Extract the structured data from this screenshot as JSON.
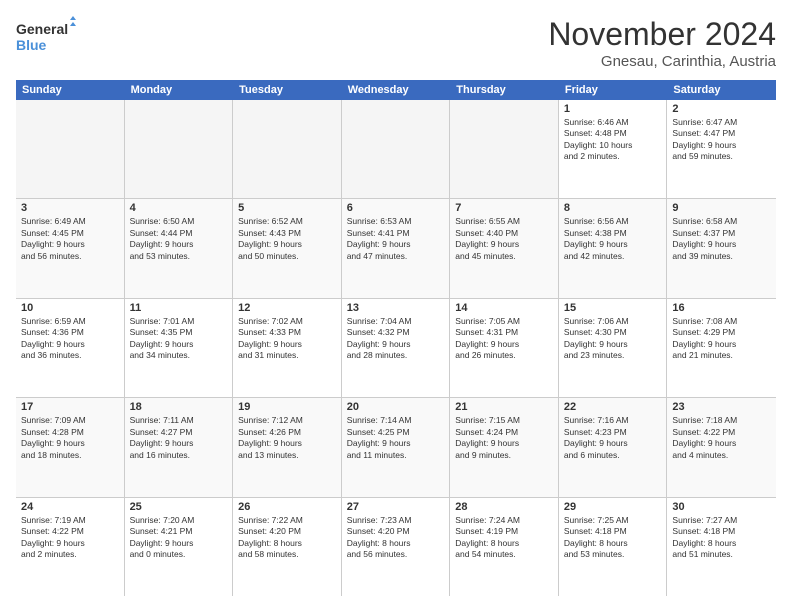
{
  "logo": {
    "line1": "General",
    "line2": "Blue"
  },
  "title": "November 2024",
  "subtitle": "Gnesau, Carinthia, Austria",
  "header_days": [
    "Sunday",
    "Monday",
    "Tuesday",
    "Wednesday",
    "Thursday",
    "Friday",
    "Saturday"
  ],
  "weeks": [
    [
      {
        "day": "",
        "info": ""
      },
      {
        "day": "",
        "info": ""
      },
      {
        "day": "",
        "info": ""
      },
      {
        "day": "",
        "info": ""
      },
      {
        "day": "",
        "info": ""
      },
      {
        "day": "1",
        "info": "Sunrise: 6:46 AM\nSunset: 4:48 PM\nDaylight: 10 hours\nand 2 minutes."
      },
      {
        "day": "2",
        "info": "Sunrise: 6:47 AM\nSunset: 4:47 PM\nDaylight: 9 hours\nand 59 minutes."
      }
    ],
    [
      {
        "day": "3",
        "info": "Sunrise: 6:49 AM\nSunset: 4:45 PM\nDaylight: 9 hours\nand 56 minutes."
      },
      {
        "day": "4",
        "info": "Sunrise: 6:50 AM\nSunset: 4:44 PM\nDaylight: 9 hours\nand 53 minutes."
      },
      {
        "day": "5",
        "info": "Sunrise: 6:52 AM\nSunset: 4:43 PM\nDaylight: 9 hours\nand 50 minutes."
      },
      {
        "day": "6",
        "info": "Sunrise: 6:53 AM\nSunset: 4:41 PM\nDaylight: 9 hours\nand 47 minutes."
      },
      {
        "day": "7",
        "info": "Sunrise: 6:55 AM\nSunset: 4:40 PM\nDaylight: 9 hours\nand 45 minutes."
      },
      {
        "day": "8",
        "info": "Sunrise: 6:56 AM\nSunset: 4:38 PM\nDaylight: 9 hours\nand 42 minutes."
      },
      {
        "day": "9",
        "info": "Sunrise: 6:58 AM\nSunset: 4:37 PM\nDaylight: 9 hours\nand 39 minutes."
      }
    ],
    [
      {
        "day": "10",
        "info": "Sunrise: 6:59 AM\nSunset: 4:36 PM\nDaylight: 9 hours\nand 36 minutes."
      },
      {
        "day": "11",
        "info": "Sunrise: 7:01 AM\nSunset: 4:35 PM\nDaylight: 9 hours\nand 34 minutes."
      },
      {
        "day": "12",
        "info": "Sunrise: 7:02 AM\nSunset: 4:33 PM\nDaylight: 9 hours\nand 31 minutes."
      },
      {
        "day": "13",
        "info": "Sunrise: 7:04 AM\nSunset: 4:32 PM\nDaylight: 9 hours\nand 28 minutes."
      },
      {
        "day": "14",
        "info": "Sunrise: 7:05 AM\nSunset: 4:31 PM\nDaylight: 9 hours\nand 26 minutes."
      },
      {
        "day": "15",
        "info": "Sunrise: 7:06 AM\nSunset: 4:30 PM\nDaylight: 9 hours\nand 23 minutes."
      },
      {
        "day": "16",
        "info": "Sunrise: 7:08 AM\nSunset: 4:29 PM\nDaylight: 9 hours\nand 21 minutes."
      }
    ],
    [
      {
        "day": "17",
        "info": "Sunrise: 7:09 AM\nSunset: 4:28 PM\nDaylight: 9 hours\nand 18 minutes."
      },
      {
        "day": "18",
        "info": "Sunrise: 7:11 AM\nSunset: 4:27 PM\nDaylight: 9 hours\nand 16 minutes."
      },
      {
        "day": "19",
        "info": "Sunrise: 7:12 AM\nSunset: 4:26 PM\nDaylight: 9 hours\nand 13 minutes."
      },
      {
        "day": "20",
        "info": "Sunrise: 7:14 AM\nSunset: 4:25 PM\nDaylight: 9 hours\nand 11 minutes."
      },
      {
        "day": "21",
        "info": "Sunrise: 7:15 AM\nSunset: 4:24 PM\nDaylight: 9 hours\nand 9 minutes."
      },
      {
        "day": "22",
        "info": "Sunrise: 7:16 AM\nSunset: 4:23 PM\nDaylight: 9 hours\nand 6 minutes."
      },
      {
        "day": "23",
        "info": "Sunrise: 7:18 AM\nSunset: 4:22 PM\nDaylight: 9 hours\nand 4 minutes."
      }
    ],
    [
      {
        "day": "24",
        "info": "Sunrise: 7:19 AM\nSunset: 4:22 PM\nDaylight: 9 hours\nand 2 minutes."
      },
      {
        "day": "25",
        "info": "Sunrise: 7:20 AM\nSunset: 4:21 PM\nDaylight: 9 hours\nand 0 minutes."
      },
      {
        "day": "26",
        "info": "Sunrise: 7:22 AM\nSunset: 4:20 PM\nDaylight: 8 hours\nand 58 minutes."
      },
      {
        "day": "27",
        "info": "Sunrise: 7:23 AM\nSunset: 4:20 PM\nDaylight: 8 hours\nand 56 minutes."
      },
      {
        "day": "28",
        "info": "Sunrise: 7:24 AM\nSunset: 4:19 PM\nDaylight: 8 hours\nand 54 minutes."
      },
      {
        "day": "29",
        "info": "Sunrise: 7:25 AM\nSunset: 4:18 PM\nDaylight: 8 hours\nand 53 minutes."
      },
      {
        "day": "30",
        "info": "Sunrise: 7:27 AM\nSunset: 4:18 PM\nDaylight: 8 hours\nand 51 minutes."
      }
    ]
  ]
}
